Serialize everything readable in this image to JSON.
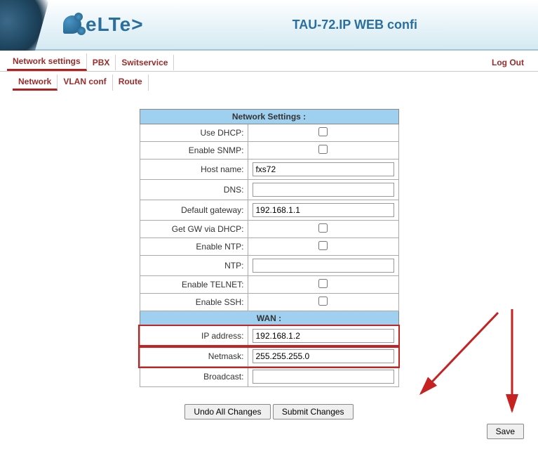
{
  "brand": "eLTe>",
  "page_title": "TAU-72.IP WEB confi",
  "tabs": {
    "items": [
      "Network settings",
      "PBX",
      "Switservice"
    ],
    "active_index": 0,
    "logout": "Log Out"
  },
  "subtabs": {
    "items": [
      "Network",
      "VLAN conf",
      "Route"
    ],
    "active_index": 0
  },
  "sections": {
    "network_settings_header": "Network Settings :",
    "wan_header": "WAN :"
  },
  "fields": {
    "use_dhcp": {
      "label": "Use DHCP:",
      "checked": false
    },
    "enable_snmp": {
      "label": "Enable SNMP:",
      "checked": false
    },
    "host_name": {
      "label": "Host name:",
      "value": "fxs72"
    },
    "dns": {
      "label": "DNS:",
      "value": ""
    },
    "default_gateway": {
      "label": "Default gateway:",
      "value": "192.168.1.1"
    },
    "get_gw_via_dhcp": {
      "label": "Get GW via DHCP:",
      "checked": false
    },
    "enable_ntp": {
      "label": "Enable NTP:",
      "checked": false
    },
    "ntp": {
      "label": "NTP:",
      "value": ""
    },
    "enable_telnet": {
      "label": "Enable TELNET:",
      "checked": false
    },
    "enable_ssh": {
      "label": "Enable SSH:",
      "checked": false
    },
    "ip_address": {
      "label": "IP address:",
      "value": "192.168.1.2"
    },
    "netmask": {
      "label": "Netmask:",
      "value": "255.255.255.0"
    },
    "broadcast": {
      "label": "Broadcast:",
      "value": ""
    }
  },
  "buttons": {
    "undo": "Undo All Changes",
    "submit": "Submit Changes",
    "save": "Save"
  }
}
